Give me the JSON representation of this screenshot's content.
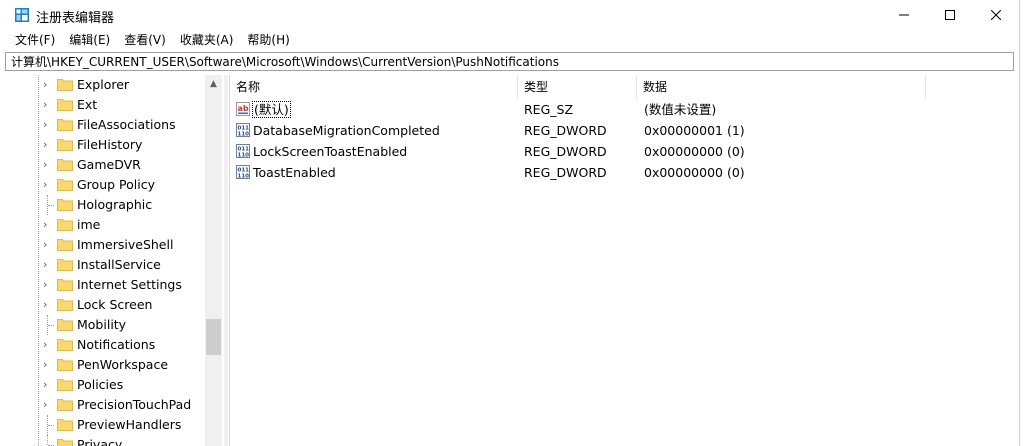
{
  "window": {
    "title": "注册表编辑器",
    "controls": {
      "minimize": "—",
      "maximize": "☐",
      "close": "✕"
    }
  },
  "menu": [
    "文件(F)",
    "编辑(E)",
    "查看(V)",
    "收藏夹(A)",
    "帮助(H)"
  ],
  "address": "计算机\\HKEY_CURRENT_USER\\Software\\Microsoft\\Windows\\CurrentVersion\\PushNotifications",
  "tree": {
    "items": [
      {
        "label": "Explorer",
        "expandable": true
      },
      {
        "label": "Ext",
        "expandable": true
      },
      {
        "label": "FileAssociations",
        "expandable": true
      },
      {
        "label": "FileHistory",
        "expandable": true
      },
      {
        "label": "GameDVR",
        "expandable": true
      },
      {
        "label": "Group Policy",
        "expandable": true
      },
      {
        "label": "Holographic",
        "expandable": false
      },
      {
        "label": "ime",
        "expandable": true
      },
      {
        "label": "ImmersiveShell",
        "expandable": true
      },
      {
        "label": "InstallService",
        "expandable": true
      },
      {
        "label": "Internet Settings",
        "expandable": true
      },
      {
        "label": "Lock Screen",
        "expandable": true
      },
      {
        "label": "Mobility",
        "expandable": false
      },
      {
        "label": "Notifications",
        "expandable": true
      },
      {
        "label": "PenWorkspace",
        "expandable": true
      },
      {
        "label": "Policies",
        "expandable": true
      },
      {
        "label": "PrecisionTouchPad",
        "expandable": true
      },
      {
        "label": "PreviewHandlers",
        "expandable": false
      },
      {
        "label": "Privacy",
        "expandable": false
      }
    ]
  },
  "columns": {
    "name": "名称",
    "type": "类型",
    "data": "数据"
  },
  "values": [
    {
      "name": "(默认)",
      "type": "REG_SZ",
      "data": "(数值未设置)",
      "icon": "string-value-icon"
    },
    {
      "name": "DatabaseMigrationCompleted",
      "type": "REG_DWORD",
      "data": "0x00000001 (1)",
      "icon": "binary-value-icon"
    },
    {
      "name": "LockScreenToastEnabled",
      "type": "REG_DWORD",
      "data": "0x00000000 (0)",
      "icon": "binary-value-icon"
    },
    {
      "name": "ToastEnabled",
      "type": "REG_DWORD",
      "data": "0x00000000 (0)",
      "icon": "binary-value-icon"
    }
  ],
  "colors": {
    "folder": "#f8d775",
    "folder_dark": "#e8b93f",
    "accent": "#0078d7"
  }
}
